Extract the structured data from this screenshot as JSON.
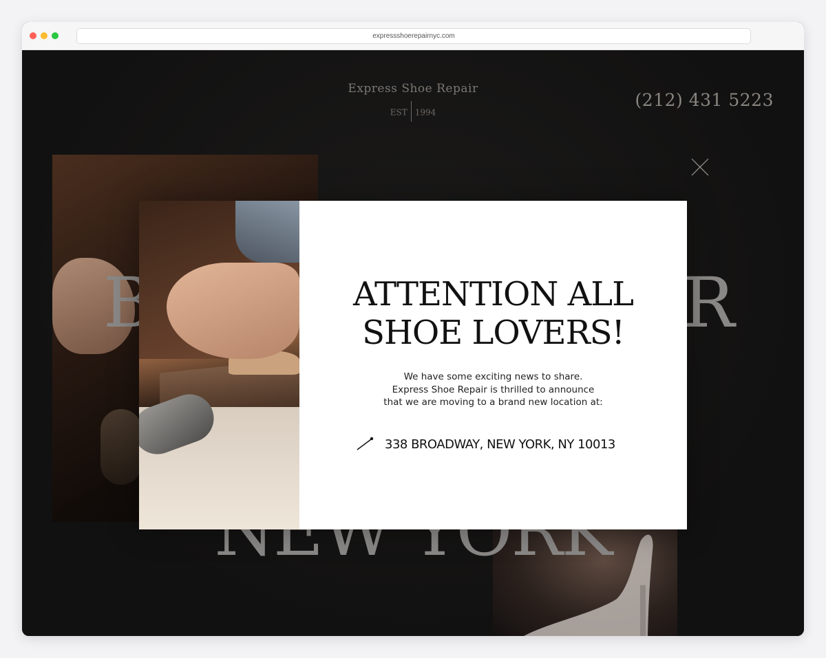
{
  "browser": {
    "url": "expressshoerepairnyc.com"
  },
  "header": {
    "brand_name": "Express Shoe Repair",
    "est_label": "EST",
    "est_year": "1994",
    "phone": "(212) 431 5223"
  },
  "hero": {
    "word_left": "B",
    "word_right": "R",
    "word_bottom": "NEW YORK"
  },
  "modal": {
    "title_line1": "ATTENTION ALL",
    "title_line2": "SHOE LOVERS!",
    "text_line1": "We have some exciting news to share.",
    "text_line2": "Express Shoe Repair is thrilled to announce",
    "text_line3": "that we are moving to a brand new location at:",
    "address": "338 BROADWAY, NEW YORK, NY 10013",
    "close_icon": "close-icon",
    "address_icon": "pin-icon"
  },
  "colors": {
    "page_bg": "#131212",
    "modal_bg": "#ffffff",
    "heading": "#111111",
    "muted_text": "#8a8681"
  }
}
